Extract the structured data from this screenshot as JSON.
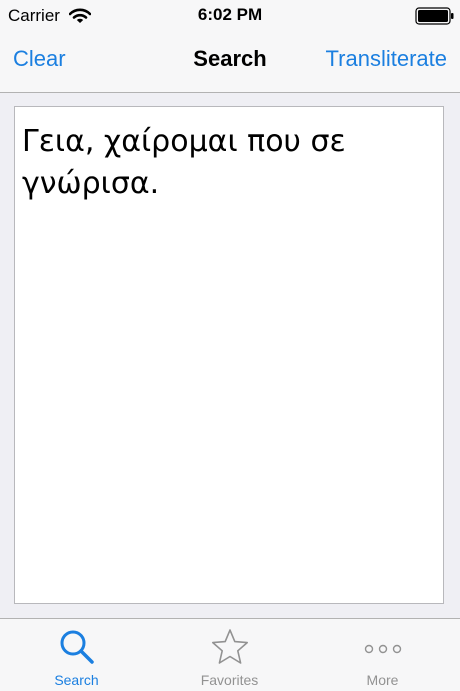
{
  "status_bar": {
    "carrier": "Carrier",
    "time": "6:02 PM"
  },
  "nav": {
    "left_button": "Clear",
    "title": "Search",
    "right_button": "Transliterate"
  },
  "editor": {
    "text": "Γεια, χαίρομαι που σε γνώρισα."
  },
  "tabbar": {
    "tabs": [
      {
        "label": "Search",
        "icon": "search-icon",
        "selected": true
      },
      {
        "label": "Favorites",
        "icon": "star-icon",
        "selected": false
      },
      {
        "label": "More",
        "icon": "more-icon",
        "selected": false
      }
    ]
  },
  "colors": {
    "accent": "#1b7fe0",
    "inactive": "#929292"
  }
}
